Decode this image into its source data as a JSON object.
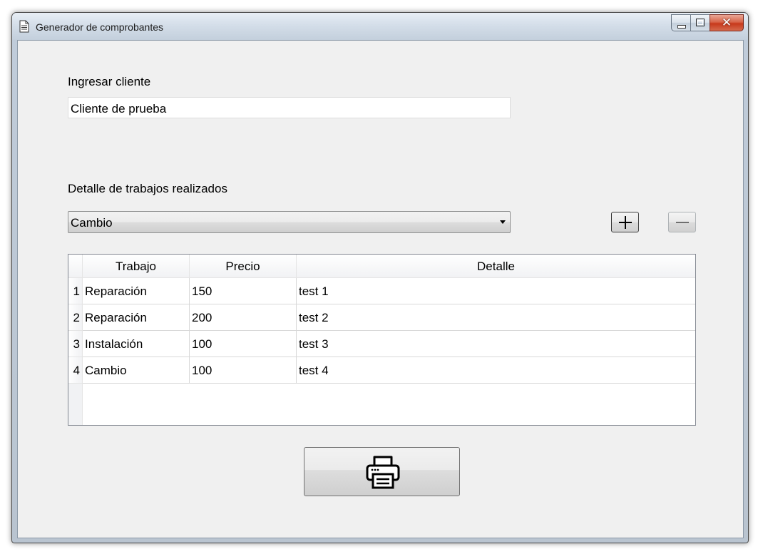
{
  "window": {
    "title": "Generador de comprobantes",
    "close_glyph": "✕",
    "icons": {
      "app": "document-icon",
      "minimize": "minimize-icon",
      "maximize": "maximize-icon",
      "close": "close-icon"
    }
  },
  "form": {
    "client_label": "Ingresar cliente",
    "client_value": "Cliente de prueba",
    "jobs_label": "Detalle de trabajos realizados",
    "job_type_selected": "Cambio",
    "add_icon": "plus-icon",
    "remove_icon": "minus-icon",
    "print_icon": "printer-icon"
  },
  "table": {
    "headers": [
      "Trabajo",
      "Precio",
      "Detalle"
    ],
    "rows": [
      {
        "num": "1",
        "trabajo": "Reparación",
        "precio": "150",
        "detalle": "test 1"
      },
      {
        "num": "2",
        "trabajo": "Reparación",
        "precio": "200",
        "detalle": "test 2"
      },
      {
        "num": "3",
        "trabajo": "Instalación",
        "precio": "100",
        "detalle": "test 3"
      },
      {
        "num": "4",
        "trabajo": "Cambio",
        "precio": "100",
        "detalle": "test 4"
      }
    ]
  },
  "colors": {
    "client_area": "#f0f0f0",
    "titlebar": "#c9d6e4",
    "close_button": "#c7391b"
  }
}
